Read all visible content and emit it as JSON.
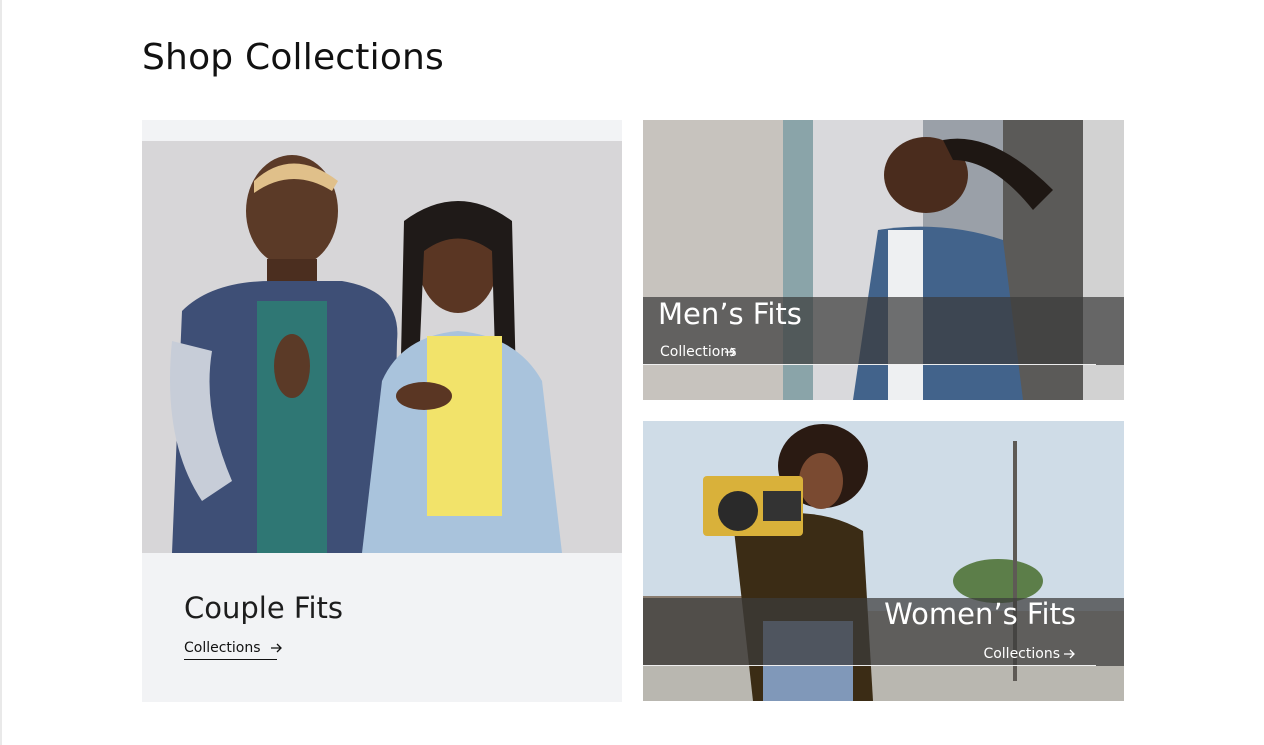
{
  "page": {
    "title": "Shop Collections"
  },
  "collections": [
    {
      "name": "Couple Fits",
      "link_label": "Collections"
    },
    {
      "name": "Men’s Fits",
      "link_label": "Collections"
    },
    {
      "name": "Women’s Fits",
      "link_label": "Collections"
    }
  ],
  "colors": {
    "card_background": "#f2f3f5",
    "overlay": "#3c3c3c",
    "text_dark": "#111111",
    "text_light": "#ffffff"
  },
  "icons": [
    "arrow-right-icon"
  ]
}
